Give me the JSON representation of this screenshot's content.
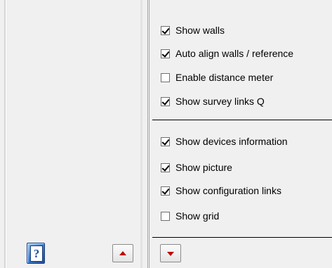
{
  "colors": {
    "panel_background": "#f0f0f0",
    "separator": "#000000",
    "arrow": "#c00000",
    "help_icon_blue": "#3f7fcf"
  },
  "options_group_1": [
    {
      "label": "Show walls",
      "checked": true
    },
    {
      "label": "Auto align walls / reference",
      "checked": true
    },
    {
      "label": "Enable distance meter",
      "checked": false
    },
    {
      "label": "Show survey links Q",
      "checked": true
    }
  ],
  "options_group_2": [
    {
      "label": "Show devices information",
      "checked": true
    },
    {
      "label": "Show picture",
      "checked": true
    },
    {
      "label": "Show configuration links",
      "checked": true
    },
    {
      "label": "Show grid",
      "checked": false
    }
  ],
  "left_panel": {
    "help_icon": "help-book-icon",
    "help_glyph": "?",
    "scroll_up_icon": "arrow-up-icon"
  },
  "right_panel": {
    "scroll_down_icon": "arrow-down-icon"
  }
}
